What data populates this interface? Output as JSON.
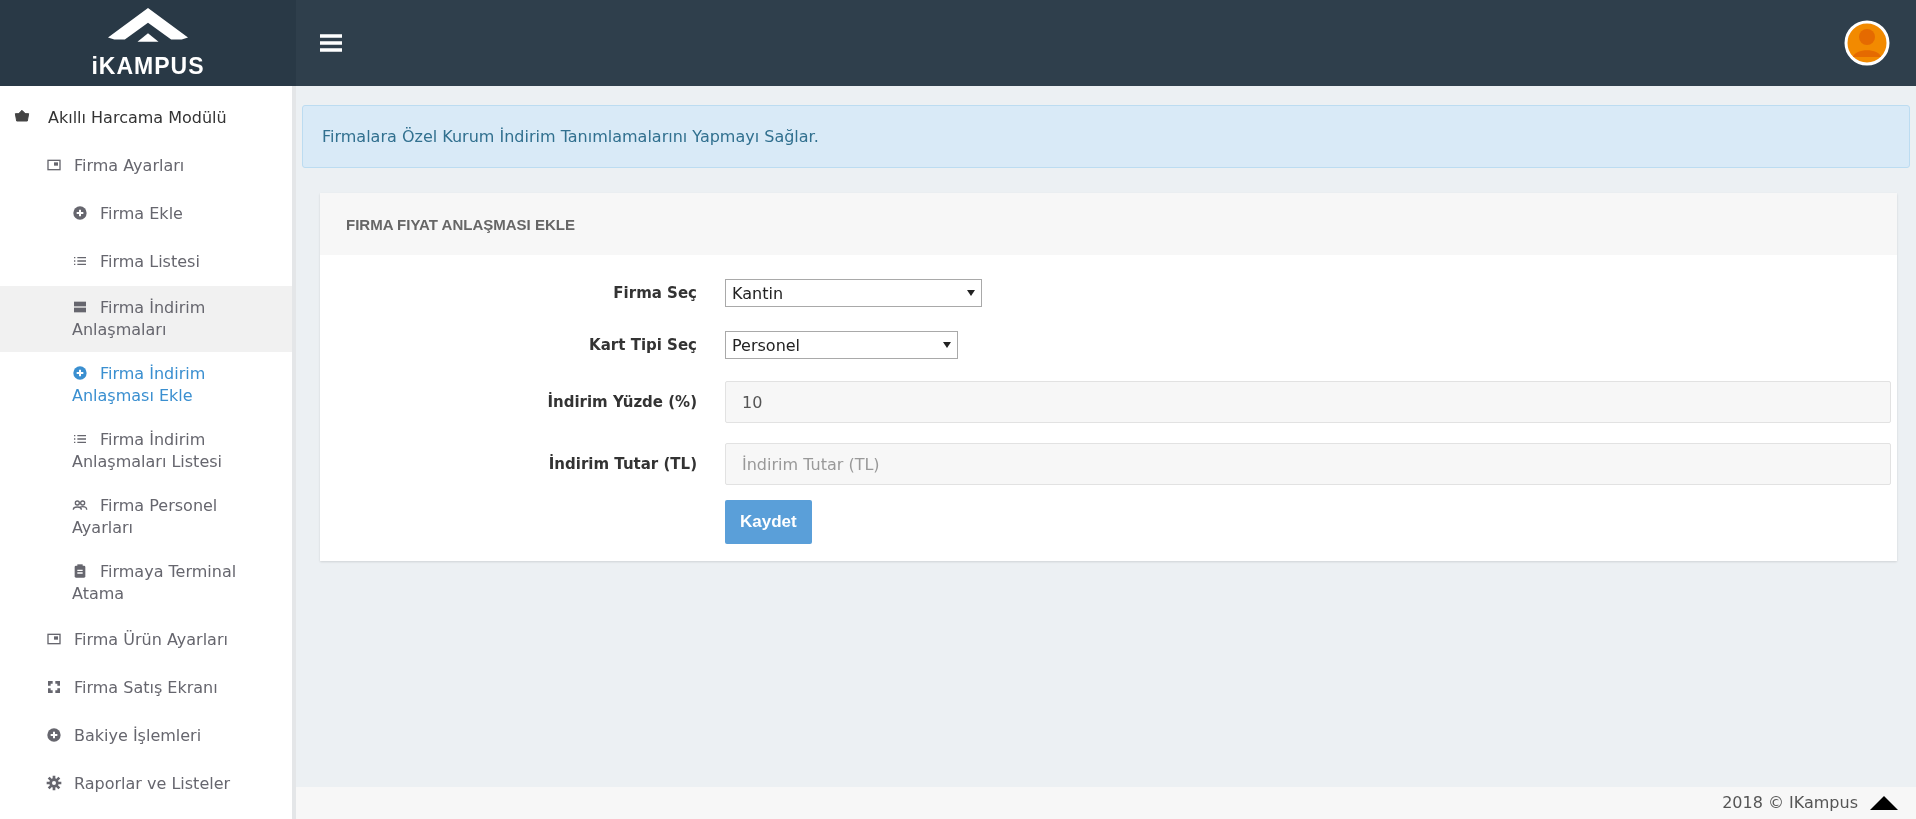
{
  "header": {
    "logo_text": "iKAMPUS"
  },
  "sidebar": {
    "items": [
      {
        "label": "Akıllı Harcama Modülü",
        "kind": "basket",
        "selected": false,
        "highlighted": false,
        "children": [
          {
            "label": "Firma Ayarları",
            "kind": "window",
            "selected": false,
            "highlighted": false,
            "children": [
              {
                "label": "Firma Ekle",
                "kind": "plus",
                "selected": false,
                "highlighted": false
              },
              {
                "label": "Firma Listesi",
                "kind": "list",
                "selected": false,
                "highlighted": false
              },
              {
                "label": "Firma İndirim Anlaşmaları",
                "kind": "server",
                "selected": false,
                "highlighted": true
              },
              {
                "label": "Firma İndirim Anlaşması Ekle",
                "kind": "plus",
                "selected": true,
                "highlighted": false
              },
              {
                "label": "Firma İndirim Anlaşmaları Listesi",
                "kind": "list",
                "selected": false,
                "highlighted": false
              },
              {
                "label": "Firma Personel Ayarları",
                "kind": "people",
                "selected": false,
                "highlighted": false
              },
              {
                "label": "Firmaya Terminal Atama",
                "kind": "clipboard",
                "selected": false,
                "highlighted": false
              }
            ]
          },
          {
            "label": "Firma Ürün Ayarları",
            "kind": "window",
            "selected": false,
            "highlighted": false
          },
          {
            "label": "Firma Satış Ekranı",
            "kind": "frame",
            "selected": false,
            "highlighted": false
          },
          {
            "label": "Bakiye İşlemleri",
            "kind": "plus",
            "selected": false,
            "highlighted": false
          },
          {
            "label": "Raporlar ve Listeler",
            "kind": "gear",
            "selected": false,
            "highlighted": false
          }
        ]
      }
    ]
  },
  "alert": {
    "text": "Firmalara Özel Kurum İndirim Tanımlamalarını Yapmayı Sağlar."
  },
  "card": {
    "title": "FIRMA FIYAT ANLAŞMASI EKLE",
    "fields": [
      {
        "kind": "select",
        "label": "Firma Seç",
        "value": "Kantin"
      },
      {
        "kind": "select",
        "label": "Kart Tipi Seç",
        "value": "Personel"
      },
      {
        "kind": "input",
        "label": "İndirim Yüzde (%)",
        "value": "10"
      },
      {
        "kind": "input",
        "label": "İndirim Tutar (TL)",
        "placeholder": "İndirim Tutar (TL)"
      }
    ],
    "button": "Kaydet"
  },
  "footer": {
    "text": "2018 © IKampus"
  }
}
